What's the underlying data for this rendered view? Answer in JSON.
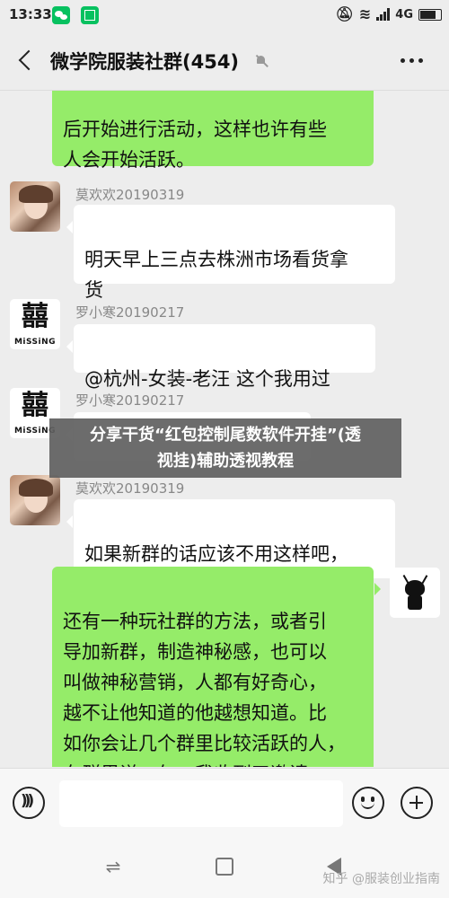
{
  "status_bar": {
    "time": "13:33",
    "network": "4G",
    "icons": [
      "wechat-icon",
      "scan-icon",
      "mute-icon",
      "wifi-icon",
      "signal-icon",
      "battery-icon"
    ]
  },
  "header": {
    "title": "微学院服装社群(454)",
    "icons": [
      "back-icon",
      "mute-bell-icon",
      "more-icon"
    ]
  },
  "messages": [
    {
      "side": "out",
      "text": "后开始进行活动，这样也许有些\n人会开始活跃。"
    },
    {
      "side": "in",
      "sender": "莫欢欢20190319",
      "avatar": "photo-avatar",
      "text": "明天早上三点去株洲市场看货拿\n货"
    },
    {
      "side": "in",
      "sender": "罗小寒20190217",
      "avatar": "missing-avatar",
      "text": "@杭州-女装-老汪  这个我用过"
    },
    {
      "side": "in",
      "sender": "罗小寒20190217",
      "avatar": "missing-avatar",
      "text": ""
    },
    {
      "side": "in",
      "sender": "莫欢欢20190319",
      "avatar": "photo-avatar",
      "text": "如果新群的话应该不用这样吧，\n我感觉很多j僵尸粉"
    },
    {
      "side": "out",
      "avatar": "robot-avatar",
      "text": "还有一种玩社群的方法，或者引\n导加新群，制造神秘感，也可以\n叫做神秘营销，人都有好奇心，\n越不让他知道的他越想知道。比\n如你会让几个群里比较活跃的人，\n在群里说一句：我收到了邀请，"
    }
  ],
  "avatar_missing": {
    "char": "囍",
    "label": "MiSSiNG"
  },
  "overlay": {
    "text": "分享干货“红包控制尾数软件开挂”(透\n视挂)辅助透视教程"
  },
  "input_bar": {
    "placeholder": "",
    "icons": [
      "voice-icon",
      "emoji-icon",
      "plus-icon"
    ]
  },
  "nav_bar": {
    "switch_glyph": "⇌",
    "icons": [
      "switch-apps-icon",
      "home-icon",
      "back-triangle-icon"
    ]
  },
  "watermark": {
    "text": "知乎 @服装创业指南"
  },
  "colors": {
    "outgoing_bubble": "#95ec69",
    "incoming_bubble": "#ffffff",
    "background": "#ededed",
    "wechat_green": "#07c160"
  }
}
